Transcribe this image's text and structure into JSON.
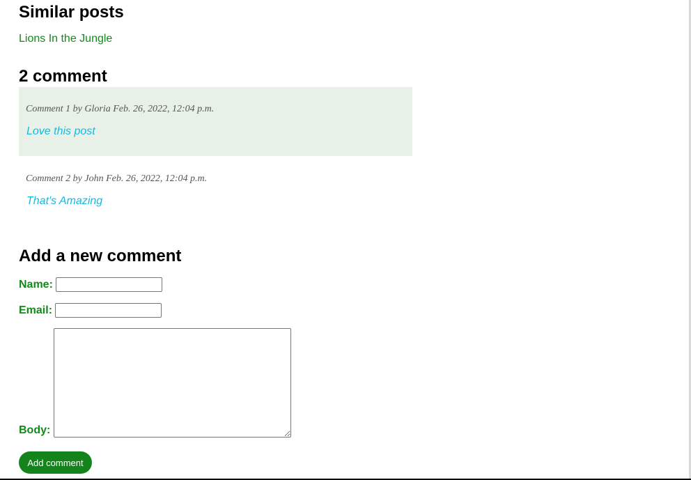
{
  "similar_posts": {
    "title": "Similar posts",
    "links": [
      {
        "label": "Lions In the Jungle"
      }
    ]
  },
  "comments": {
    "count_title": "2 comment",
    "items": [
      {
        "meta": "Comment 1 by Gloria Feb. 26, 2022, 12:04 p.m.",
        "body": "Love this post"
      },
      {
        "meta": "Comment 2 by John Feb. 26, 2022, 12:04 p.m.",
        "body": "That's Amazing"
      }
    ]
  },
  "form": {
    "title": "Add a new comment",
    "name_label": "Name:",
    "name_value": "",
    "email_label": "Email:",
    "email_value": "",
    "body_label": "Body:",
    "body_value": "",
    "submit_label": "Add comment"
  },
  "colors": {
    "accent_green": "#118a19",
    "button_green": "#12841a",
    "comment_highlight_bg": "#e7f1e7",
    "comment_body_cyan": "#18b8e0"
  }
}
